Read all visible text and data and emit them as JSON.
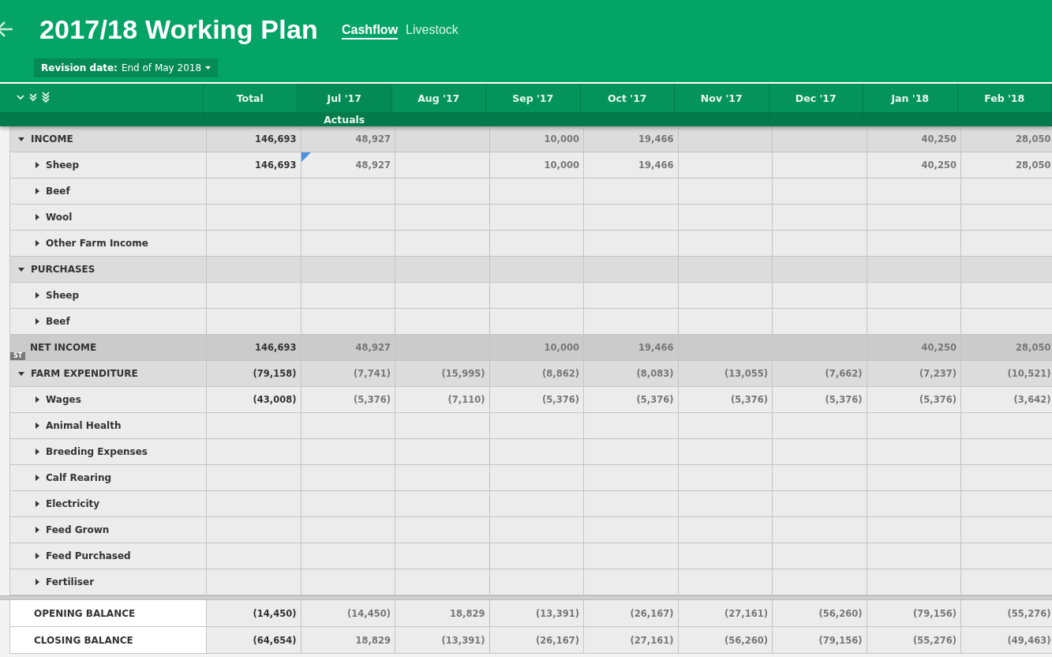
{
  "header": {
    "title": "2017/18 Working Plan",
    "tabs": [
      {
        "label": "Cashflow",
        "selected": true
      },
      {
        "label": "Livestock",
        "selected": false
      }
    ],
    "revision": {
      "label": "Revision date:",
      "value": "End of May 2018"
    }
  },
  "table": {
    "columns": [
      {
        "label": "Total"
      },
      {
        "label": "Jul '17",
        "sublabel": "Actuals"
      },
      {
        "label": "Aug '17"
      },
      {
        "label": "Sep '17"
      },
      {
        "label": "Oct '17"
      },
      {
        "label": "Nov '17"
      },
      {
        "label": "Dec '17"
      },
      {
        "label": "Jan '18"
      },
      {
        "label": "Feb '18"
      }
    ],
    "rows": [
      {
        "kind": "section",
        "label": "INCOME",
        "cells": [
          {
            "kind": "amount",
            "text": "146,693"
          },
          {
            "kind": "amount",
            "text": "48,927"
          },
          {
            "kind": "blank"
          },
          {
            "kind": "amount",
            "text": "10,000"
          },
          {
            "kind": "amount",
            "text": "19,466"
          },
          {
            "kind": "blank"
          },
          {
            "kind": "blank"
          },
          {
            "kind": "amount",
            "text": "40,250"
          },
          {
            "kind": "amount",
            "text": "28,050"
          }
        ]
      },
      {
        "kind": "item",
        "label": "Sheep",
        "note_marker": true,
        "cells": [
          {
            "kind": "amount",
            "text": "146,693"
          },
          {
            "kind": "amount",
            "text": "48,927"
          },
          {
            "kind": "blank"
          },
          {
            "kind": "amount",
            "text": "10,000"
          },
          {
            "kind": "amount",
            "text": "19,466"
          },
          {
            "kind": "blank"
          },
          {
            "kind": "blank"
          },
          {
            "kind": "amount",
            "text": "40,250"
          },
          {
            "kind": "amount",
            "text": "28,050"
          }
        ]
      },
      {
        "kind": "item",
        "label": "Beef",
        "note_marker": false
      },
      {
        "kind": "item",
        "label": "Wool",
        "note_marker": false
      },
      {
        "kind": "item",
        "label": "Other Farm Income",
        "note_marker": false
      },
      {
        "kind": "section",
        "label": "PURCHASES"
      },
      {
        "kind": "item",
        "label": "Sheep",
        "note_marker": false
      },
      {
        "kind": "item",
        "label": "Beef",
        "note_marker": false
      },
      {
        "kind": "subtotal",
        "label": "NET INCOME",
        "badge": "ST",
        "cells": [
          {
            "kind": "amount",
            "text": "146,693"
          },
          {
            "kind": "amount",
            "text": "48,927"
          },
          {
            "kind": "blank"
          },
          {
            "kind": "amount",
            "text": "10,000"
          },
          {
            "kind": "amount",
            "text": "19,466"
          },
          {
            "kind": "blank"
          },
          {
            "kind": "blank"
          },
          {
            "kind": "amount",
            "text": "40,250"
          },
          {
            "kind": "amount",
            "text": "28,050"
          }
        ]
      },
      {
        "kind": "section",
        "label": "FARM EXPENDITURE",
        "cells": [
          {
            "kind": "amount",
            "text": "(79,158)"
          },
          {
            "kind": "amount",
            "text": "(7,741)"
          },
          {
            "kind": "amount",
            "text": "(15,995)"
          },
          {
            "kind": "amount",
            "text": "(8,862)"
          },
          {
            "kind": "amount",
            "text": "(8,083)"
          },
          {
            "kind": "amount",
            "text": "(13,055)"
          },
          {
            "kind": "amount",
            "text": "(7,662)"
          },
          {
            "kind": "amount",
            "text": "(7,237)"
          },
          {
            "kind": "amount",
            "text": "(10,521)"
          }
        ]
      },
      {
        "kind": "item",
        "label": "Wages",
        "note_marker": false,
        "cells": [
          {
            "kind": "amount",
            "text": "(43,008)"
          },
          {
            "kind": "amount",
            "text": "(5,376)"
          },
          {
            "kind": "amount",
            "text": "(7,110)"
          },
          {
            "kind": "amount",
            "text": "(5,376)"
          },
          {
            "kind": "amount",
            "text": "(5,376)"
          },
          {
            "kind": "amount",
            "text": "(5,376)"
          },
          {
            "kind": "amount",
            "text": "(5,376)"
          },
          {
            "kind": "amount",
            "text": "(5,376)"
          },
          {
            "kind": "amount",
            "text": "(3,642)"
          }
        ]
      },
      {
        "kind": "item",
        "label": "Animal Health",
        "note_marker": false
      },
      {
        "kind": "item",
        "label": "Breeding Expenses",
        "note_marker": false
      },
      {
        "kind": "item",
        "label": "Calf Rearing",
        "note_marker": false
      },
      {
        "kind": "item",
        "label": "Electricity",
        "note_marker": false
      },
      {
        "kind": "item",
        "label": "Feed Grown",
        "note_marker": false
      },
      {
        "kind": "item",
        "label": "Feed Purchased",
        "note_marker": false
      },
      {
        "kind": "item",
        "label": "Fertiliser",
        "note_marker": false
      }
    ],
    "balances": [
      {
        "label": "OPENING BALANCE",
        "cells": [
          {
            "kind": "amount",
            "text": "(14,450)"
          },
          {
            "kind": "amount",
            "text": "(14,450)"
          },
          {
            "kind": "amount",
            "text": "18,829"
          },
          {
            "kind": "amount",
            "text": "(13,391)"
          },
          {
            "kind": "amount",
            "text": "(26,167)"
          },
          {
            "kind": "amount",
            "text": "(27,161)"
          },
          {
            "kind": "amount",
            "text": "(56,260)"
          },
          {
            "kind": "amount",
            "text": "(79,156)"
          },
          {
            "kind": "amount",
            "text": "(55,276)"
          }
        ]
      },
      {
        "label": "CLOSING BALANCE",
        "cells": [
          {
            "kind": "amount",
            "text": "(64,654)"
          },
          {
            "kind": "amount",
            "text": "18,829"
          },
          {
            "kind": "amount",
            "text": "(13,391)"
          },
          {
            "kind": "amount",
            "text": "(26,167)"
          },
          {
            "kind": "amount",
            "text": "(27,161)"
          },
          {
            "kind": "amount",
            "text": "(56,260)"
          },
          {
            "kind": "amount",
            "text": "(79,156)"
          },
          {
            "kind": "amount",
            "text": "(55,276)"
          },
          {
            "kind": "amount",
            "text": "(49,463)"
          }
        ]
      }
    ]
  }
}
